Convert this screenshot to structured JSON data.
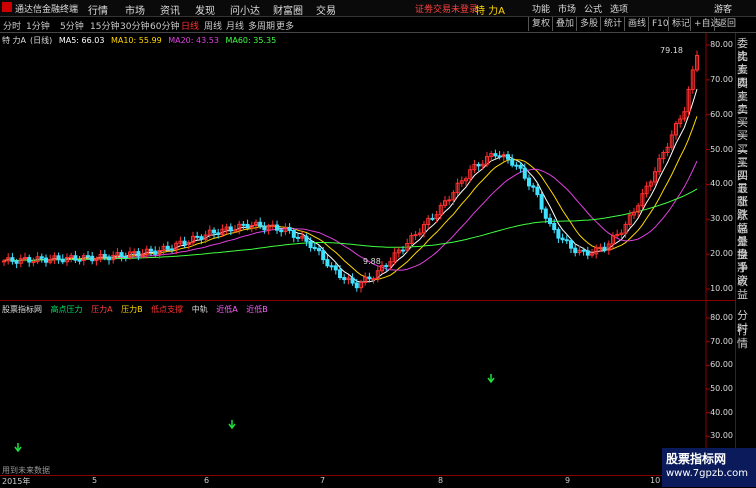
{
  "titlebar": {
    "app_name": "通达信金融终端",
    "menus": [
      "行情",
      "市场",
      "资讯",
      "发现",
      "问小达",
      "财富圈",
      "交易"
    ],
    "alert": "证劵交易未登录",
    "stock_name": "特 力A",
    "right_menus": [
      "功能",
      "市场",
      "公式",
      "选项",
      "游客"
    ]
  },
  "periods": {
    "items": [
      "分时",
      "1分钟",
      "5分钟",
      "15分钟",
      "30分钟",
      "60分钟",
      "日线",
      "周线",
      "月线",
      "多周期",
      "更多"
    ],
    "active": "日线"
  },
  "toolbar": [
    "复权",
    "叠加",
    "多股",
    "统计",
    "画线",
    "F10",
    "标记",
    "+自选",
    "返回"
  ],
  "info": {
    "stock": "特 力A",
    "period": "(日线)",
    "ma5": "MA5: 66.03",
    "ma10": "MA10: 55.99",
    "ma20": "MA20: 43.53",
    "ma60": "MA60: 35.35"
  },
  "price_axis": [
    "80.00",
    "70.00",
    "60.00",
    "50.00",
    "40.00",
    "30.00",
    "20.00",
    "10.00"
  ],
  "ind_axis": [
    "80.00",
    "70.00",
    "60.00",
    "50.00",
    "40.00",
    "30.00",
    "20.00"
  ],
  "price_marks": {
    "high": "79.18",
    "low": "9.88"
  },
  "indicator": {
    "name": "股票指标网",
    "items": [
      {
        "label": "高点压力",
        "color": "#00e060"
      },
      {
        "label": "压力A",
        "color": "#ff4040"
      },
      {
        "label": "压力B",
        "color": "#ffd700"
      },
      {
        "label": "低点支撑",
        "color": "#ff3030"
      },
      {
        "label": "中轨",
        "color": "#dddddd"
      },
      {
        "label": "近低A",
        "color": "#ff60ff"
      },
      {
        "label": "近低B",
        "color": "#ff60ff"
      }
    ],
    "footnote": "用到未来数据"
  },
  "side_tabs_top": [
    "委比",
    "卖五",
    "卖四",
    "卖三",
    "卖二",
    "卖一",
    "买一",
    "买二",
    "买三",
    "买四",
    "买五",
    "最新",
    "涨跌",
    "涨幅",
    "总量",
    "外盘",
    "换手",
    "净资",
    "收益"
  ],
  "side_tabs_bottom": [
    "分时",
    "行情"
  ],
  "dates": [
    "2015年",
    "5",
    "6",
    "7",
    "8",
    "9",
    "10"
  ],
  "watermark": {
    "line1": "股票指标网",
    "line2": "www.7gpzb.com"
  },
  "colors": {
    "up": "#ff3030",
    "down": "#40e0ff",
    "ma5": "#ffffff",
    "ma10": "#ffd700",
    "ma20": "#e040e0",
    "ma60": "#40ff40",
    "frame": "#8a0000"
  }
}
